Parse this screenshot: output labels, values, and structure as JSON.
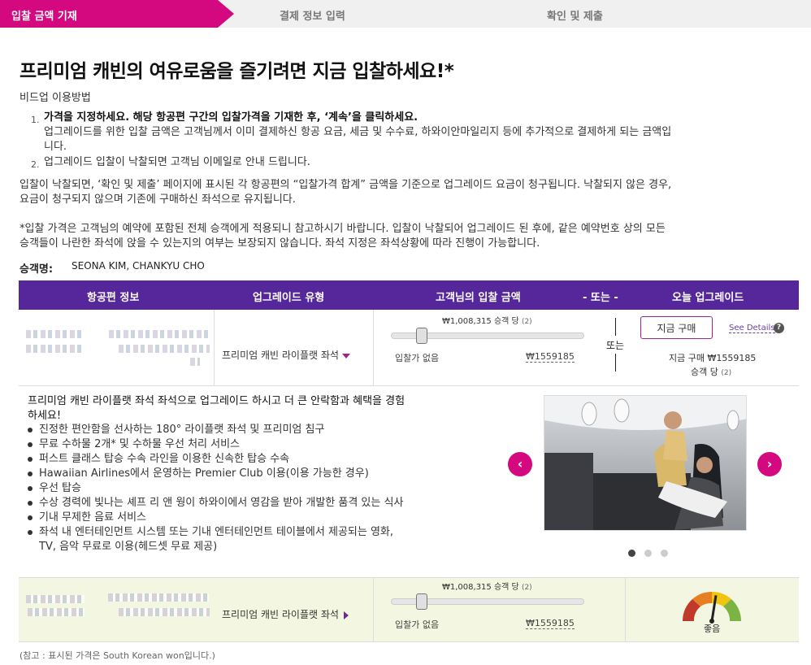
{
  "steps": {
    "step1": "입찰 금액 기재",
    "step2": "결제 정보 입력",
    "step3": "확인 및 제출"
  },
  "page_title": "프리미엄 캐빈의 여유로움을 즐기려면 지금 입찰하세요!*",
  "howto_title": "비드업 이용방법",
  "instructions": {
    "n1": "1.",
    "item1_bold": "가격을 지정하세요. 해당 항공편 구간의 입찰가격을 기재한 후, ‘계속’을 클릭하세요.",
    "item1_text_a": "업그레이드를 위한 입찰 금액은 고객님께서 이미 결제하신 항공 요금, 세금 및 수수료, 하와이안마일리지 등에 추가적으로 결제하게 되는 금액입",
    "item1_text_b": "니다.",
    "n2": "2.",
    "item2": "업그레이드 입찰이 낙찰되면 고객님 이메일로 안내 드립니다."
  },
  "para1_a": "입찰이 낙찰되면, ‘확인 및 제출’ 페이지에 표시된 각 항공편의 “입찰가격 합계” 금액을 기준으로 업그레이드 요금이 청구됩니다. 낙찰되지 않은 경우,",
  "para1_b": "요금이 청구되지 않으며 기존에 구매하신 좌석으로 유지됩니다.",
  "para2_a": "*입찰 가격은 고객님의 예약에 포함된 전체 승객에게 적용되니 참고하시기 바랍니다. 입찰이 낙찰되어 업그레이드 된 후에, 같은 예약번호 상의 모든",
  "para2_b": "승객들이 나란한 좌석에 앉을 수 있는지의 여부는 보장되지 않습니다. 좌석 지정은 좌석상황에 따라 진행이 가능합니다.",
  "passengers": {
    "label": "승객명:",
    "names": "SEONA KIM, CHANKYU CHO"
  },
  "table_header": {
    "flight_info": "항공편 정보",
    "upgrade_type": "업그레이드 유형",
    "your_bid": "고객님의 입찰 금액",
    "or": "- 또는 -",
    "upgrade_today": "오늘 업그레이드"
  },
  "row1": {
    "cabin": "프리미엄 캐빈 라이플랫 좌석",
    "bid_value": "₩1,008,315 승객 당",
    "bid_count": "(2)",
    "bid_fraction": 0.16,
    "min_label": "입찰가 없음",
    "max_label": "₩1559185",
    "or": "또는",
    "buy_button": "지금 구매",
    "see_details": "See Details",
    "help": "?",
    "buy_now_price": "지금 구매 ₩1559185",
    "per_passenger": "승객 당",
    "per_passenger_count": "(2)"
  },
  "description": {
    "intro": "프리미엄 캐빈 라이플랫 좌석 좌석으로 업그레이드 하시고 더 큰 안락함과 혜택을 경험하세요!",
    "features": [
      "진정한 편안함을 선사하는 180° 라이플랫 좌석 및 프리미엄 침구",
      "무료 수하물 2개* 및 수하물 우선 처리 서비스",
      "퍼스트 클래스 탑승 수속 라인을 이용한 신속한 탑승 수속",
      "Hawaiian Airlines에서 운영하는 Premier Club 이용(이용 가능한 경우)",
      "우선 탑승",
      "수상 경력에 빛나는 셰프 리 앤 웡이 하와이에서 영감을 받아 개발한 품격 있는 식사",
      "기내 무제한 음료 서비스",
      "좌석 내 엔터테인먼트 시스템 또는 기내 엔터테인먼트 테이블에서 제공되는 영화, TV, 음악 무료로 이용(헤드셋 무료 제공)"
    ]
  },
  "carousel": {
    "prev": "‹",
    "next": "›",
    "active_index": 0,
    "count": 3
  },
  "row2": {
    "cabin": "프리미엄 캐빈 라이플랫 좌석",
    "bid_value": "₩1,008,315 승객 당",
    "bid_count": "(2)",
    "bid_fraction": 0.16,
    "min_label": "입찰가 없음",
    "max_label": "₩1559185",
    "gauge_label": "좋음",
    "gauge_level": 0.55
  },
  "footnote": "(참고 : 표시된 가격은 South Korean won입니다.)",
  "colors": {
    "accent": "#d4087f",
    "header_purple": "#55279a",
    "row_highlight": "#f3f6e0"
  }
}
